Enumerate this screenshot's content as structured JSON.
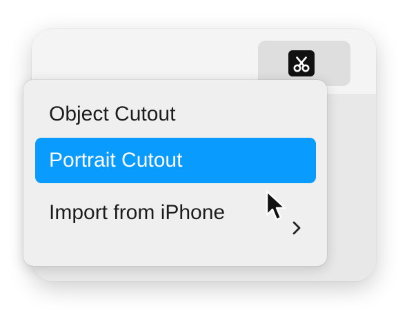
{
  "toolbar": {
    "tool_icon": "scissors-icon"
  },
  "menu": {
    "items": [
      {
        "label": "Object Cutout",
        "state": "normal"
      },
      {
        "label": "Portrait Cutout",
        "state": "highlighted"
      },
      {
        "label": "Import from iPhone",
        "state": "normal",
        "submenu_icon": "chevron-right-icon"
      }
    ]
  },
  "colors": {
    "highlight": "#0a9bff",
    "menu_background": "#efefef",
    "toolbar_button": "#dedede"
  }
}
